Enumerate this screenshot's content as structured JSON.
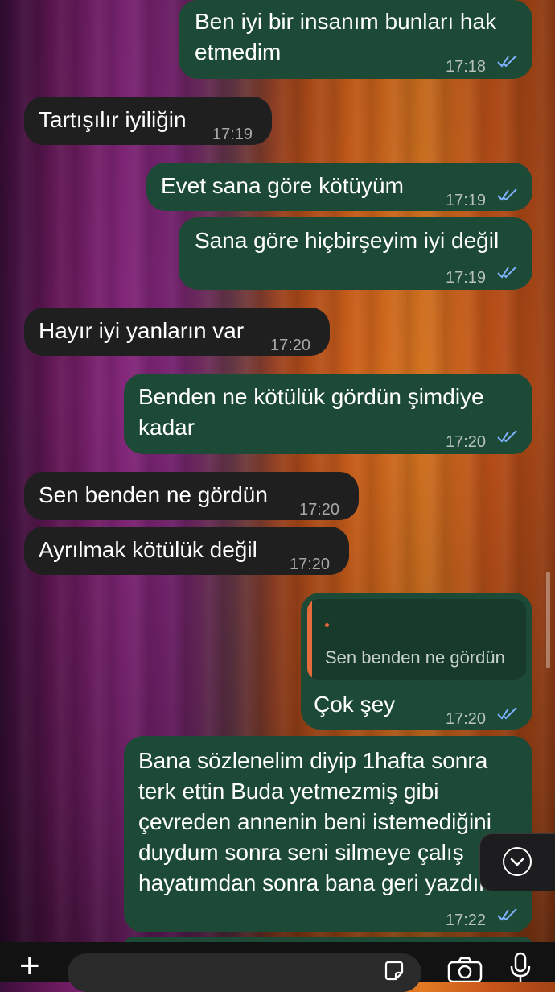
{
  "messages": [
    {
      "text": "Ben iyi bir insanım bunları hak etmedim",
      "time": "17:18"
    },
    {
      "text": "Tartışılır iyiliğin",
      "time": "17:19"
    },
    {
      "text": "Evet sana göre kötüyüm",
      "time": "17:19"
    },
    {
      "text": "Sana göre hiçbirşeyim iyi değil",
      "time": "17:19"
    },
    {
      "text": "Hayır iyi yanların var",
      "time": "17:20"
    },
    {
      "text": "Benden ne kötülük gördün şimdiye kadar",
      "time": "17:20"
    },
    {
      "text": "Sen benden ne gördün",
      "time": "17:20"
    },
    {
      "text": "Ayrılmak kötülük değil",
      "time": "17:20"
    },
    {
      "quote": "Sen benden ne gördün",
      "text": "Çok şey",
      "time": "17:20"
    },
    {
      "text": "Bana sözlenelim diyip 1hafta sonra terk ettin Buda yetmezmiş gibi çevreden annenin beni istemediğini duydum sonra seni silmeye çalış hayatımdan sonra bana geri yazdın",
      "time": "17:22"
    }
  ],
  "composer": {
    "plus_icon": "plus-icon",
    "sticker_icon": "sticker-icon",
    "camera_icon": "camera-icon",
    "mic_icon": "microphone-icon"
  },
  "colors": {
    "outgoing": "#1d4a36",
    "incoming": "#1f1f1f",
    "read_ticks": "#7fb2ff",
    "reply_bar": "#e66b3a"
  }
}
